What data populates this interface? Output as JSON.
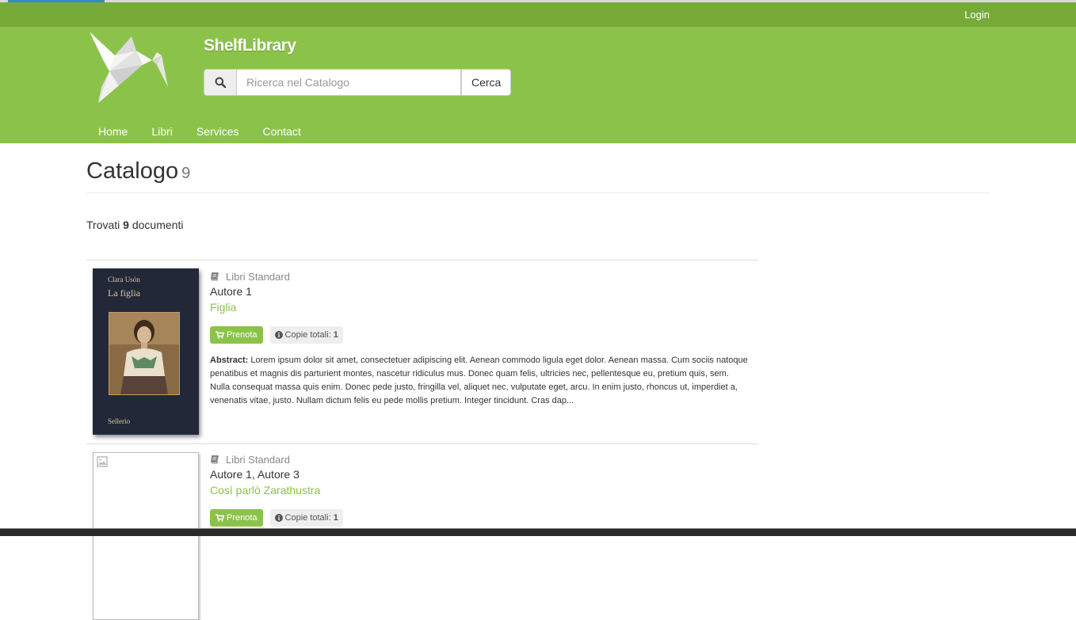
{
  "header": {
    "login_label": "Login",
    "site_title": "ShelfLibrary",
    "search_placeholder": "Ricerca nel Catalogo",
    "search_button": "Cerca",
    "nav": [
      "Home",
      "Libri",
      "Services",
      "Contact"
    ],
    "brand_color": "#8bc34a",
    "topbar_color": "#76ab38"
  },
  "main": {
    "title": "Catalogo",
    "count": "9",
    "found_prefix": "Trovati",
    "found_count": "9",
    "found_suffix": "documenti"
  },
  "books": [
    {
      "category": "Libri Standard",
      "authors": "Autore 1",
      "title": "Figlia",
      "reserve_label": "Prenota",
      "copies_label": "Copie totali:",
      "copies": "1",
      "abstract_label": "Abstract:",
      "abstract": "Lorem ipsum dolor sit amet, consectetuer adipiscing elit. Aenean commodo ligula eget dolor. Aenean massa. Cum sociis natoque penatibus et magnis dis parturient montes, nascetur ridiculus mus. Donec quam felis, ultricies nec, pellentesque eu, pretium quis, sem. Nulla consequat massa quis enim. Donec pede justo, fringilla vel, aliquet nec, vulputate eget, arcu. In enim justo, rhoncus ut, imperdiet a, venenatis vitae, justo. Nullam dictum felis eu pede mollis pretium. Integer tincidunt. Cras dap...",
      "cover": {
        "author": "Clara Usón",
        "title": "La figlia",
        "publisher": "Sellerio"
      }
    },
    {
      "category": "Libri Standard",
      "authors": "Autore 1, Autore 3",
      "title": "Così parlò Zarathustra",
      "reserve_label": "Prenota",
      "copies_label": "Copie totali:",
      "copies": "1"
    }
  ],
  "icons": {
    "search": "search-icon",
    "book": "book-icon",
    "cart": "shopping-cart-icon",
    "info": "info-circle-icon",
    "broken_image": "broken-image-icon",
    "logo": "origami-bird-logo"
  }
}
